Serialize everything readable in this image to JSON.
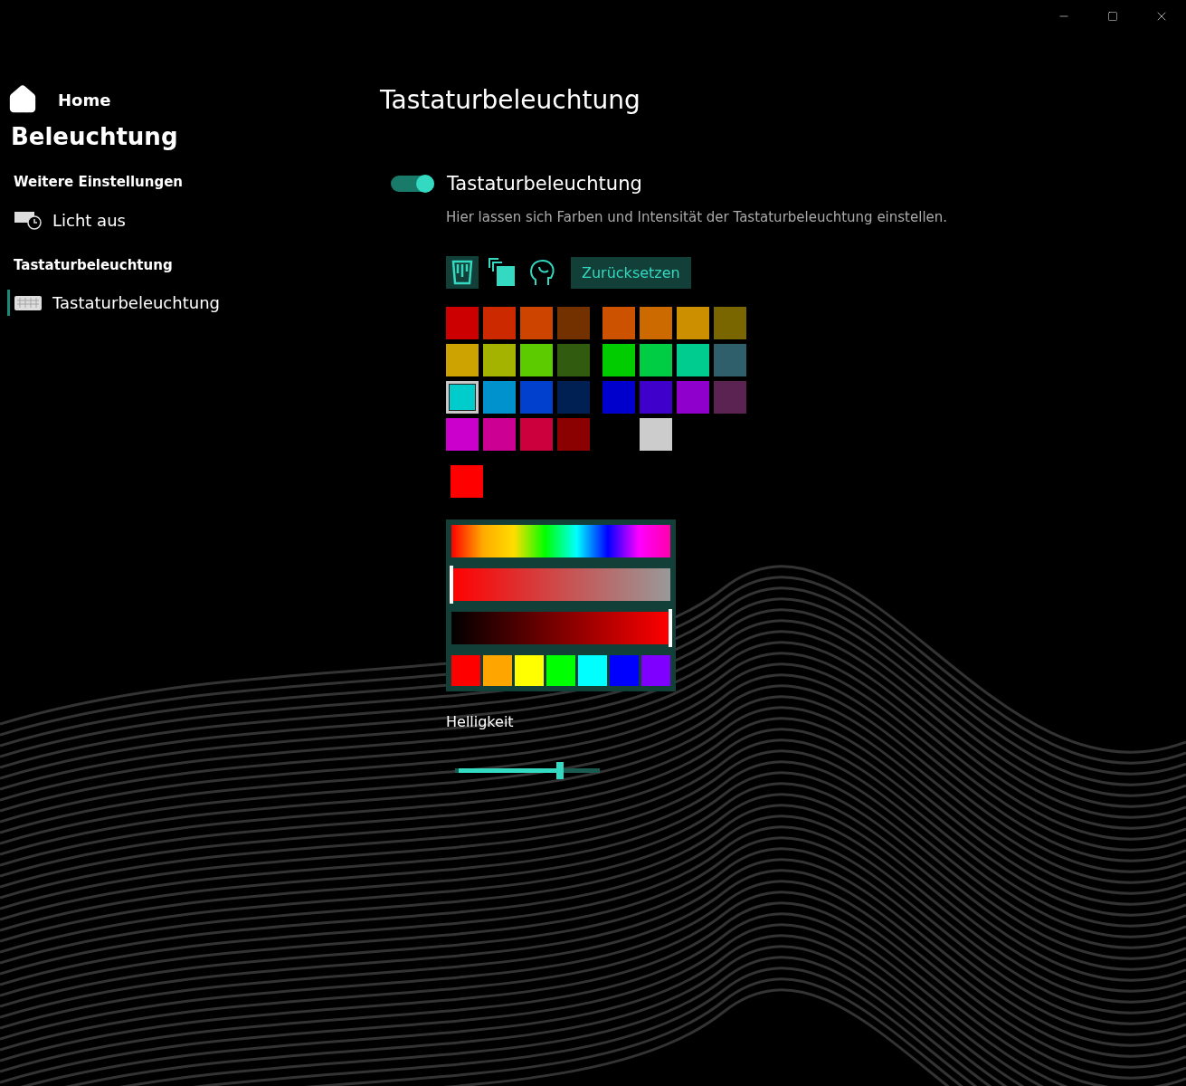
{
  "sidebar": {
    "home": "Home",
    "title": "Beleuchtung",
    "sections": [
      {
        "heading": "Weitere Einstellungen",
        "items": [
          {
            "label": "Licht aus",
            "kind": "timer",
            "selected": false
          }
        ]
      },
      {
        "heading": "Tastaturbeleuchtung",
        "items": [
          {
            "label": "Tastaturbeleuchtung",
            "kind": "keyboard",
            "selected": true
          }
        ]
      }
    ]
  },
  "page": {
    "title": "Tastaturbeleuchtung",
    "toggle": {
      "label": "Tastaturbeleuchtung",
      "on": true
    },
    "description": "Hier lassen sich Farben und Intensität der Tastaturbeleuchtung einstellen.",
    "tools": [
      {
        "kind": "bucket",
        "selected": true
      },
      {
        "kind": "copy",
        "selected": false
      },
      {
        "kind": "head",
        "selected": false
      }
    ],
    "reset_button": "Zurücksetzen",
    "swatch_groups": [
      {
        "swatches": [
          {
            "kind": "swatch",
            "color": "#cc0000",
            "selected": false
          },
          {
            "kind": "swatch",
            "color": "#cc2900",
            "selected": false
          },
          {
            "kind": "swatch",
            "color": "#cc4400",
            "selected": false
          },
          {
            "kind": "swatch",
            "color": "#733100",
            "selected": false
          },
          {
            "kind": "swatch",
            "color": "#cca300",
            "selected": false
          },
          {
            "kind": "swatch",
            "color": "#a3b300",
            "selected": false
          },
          {
            "kind": "swatch",
            "color": "#5ccc00",
            "selected": false
          },
          {
            "kind": "swatch",
            "color": "#315c10",
            "selected": false
          },
          {
            "kind": "swatch",
            "color": "#00cccc",
            "selected": true
          },
          {
            "kind": "swatch",
            "color": "#0092cc",
            "selected": false
          },
          {
            "kind": "swatch",
            "color": "#0040cc",
            "selected": false
          },
          {
            "kind": "swatch",
            "color": "#001f52",
            "selected": false
          },
          {
            "kind": "swatch",
            "color": "#cc00cc",
            "selected": false
          },
          {
            "kind": "swatch",
            "color": "#cc0092",
            "selected": false
          },
          {
            "kind": "swatch",
            "color": "#cc003d",
            "selected": false
          },
          {
            "kind": "swatch",
            "color": "#8b0000",
            "selected": false
          }
        ]
      },
      {
        "swatches": [
          {
            "kind": "swatch",
            "color": "#cc5200",
            "selected": false
          },
          {
            "kind": "swatch",
            "color": "#cc6a00",
            "selected": false
          },
          {
            "kind": "swatch",
            "color": "#cc8f00",
            "selected": false
          },
          {
            "kind": "swatch",
            "color": "#7a6600",
            "selected": false
          },
          {
            "kind": "swatch",
            "color": "#00cc00",
            "selected": false
          },
          {
            "kind": "swatch",
            "color": "#00cc44",
            "selected": false
          },
          {
            "kind": "swatch",
            "color": "#00cc8f",
            "selected": false
          },
          {
            "kind": "swatch",
            "color": "#2e5f6a",
            "selected": false
          },
          {
            "kind": "swatch",
            "color": "#0000cc",
            "selected": false
          },
          {
            "kind": "swatch",
            "color": "#4000cc",
            "selected": false
          },
          {
            "kind": "swatch",
            "color": "#8f00cc",
            "selected": false
          },
          {
            "kind": "swatch",
            "color": "#5a2352",
            "selected": false
          },
          {
            "kind": "empty"
          },
          {
            "kind": "swatch",
            "color": "#cccccc",
            "selected": false
          },
          {
            "kind": "empty"
          },
          {
            "kind": "empty"
          }
        ]
      }
    ],
    "current_swatch": {
      "color": "#ff0000"
    },
    "picker": {
      "saturation": {
        "level": 0
      },
      "value": {
        "level": 1
      },
      "presets": [
        {
          "color": "#ff0000"
        },
        {
          "color": "#ffa500"
        },
        {
          "color": "#ffff00"
        },
        {
          "color": "#00ff00"
        },
        {
          "color": "#00ffff"
        },
        {
          "color": "#0000ff"
        },
        {
          "color": "#8000ff"
        }
      ]
    },
    "brightness": {
      "label": "Helligkeit",
      "level": 0.74
    }
  }
}
